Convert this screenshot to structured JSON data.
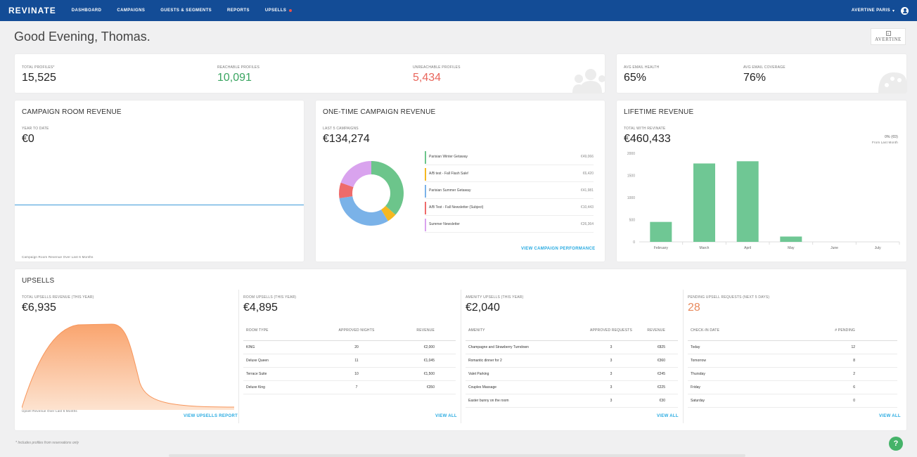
{
  "nav": {
    "logo": "REVINATE",
    "items": [
      "DASHBOARD",
      "CAMPAIGNS",
      "GUESTS & SEGMENTS",
      "REPORTS",
      "UPSELLS"
    ],
    "account": "AVERTINE PARIS",
    "accent": "#134c96"
  },
  "greeting": "Good Evening, Thomas.",
  "brand_logo": {
    "mark": "A",
    "name": "AVERTINE"
  },
  "profiles": {
    "total_label": "TOTAL PROFILES*",
    "total_value": "15,525",
    "reachable_label": "REACHABLE PROFILES",
    "reachable_value": "10,091",
    "unreachable_label": "UNREACHABLE PROFILES",
    "unreachable_value": "5,434"
  },
  "email": {
    "health_label": "AVG EMAIL HEALTH",
    "health_value": "65%",
    "coverage_label": "AVG EMAIL COVERAGE",
    "coverage_value": "76%"
  },
  "campaign_room": {
    "title": "CAMPAIGN ROOM REVENUE",
    "label": "YEAR TO DATE",
    "value": "€0",
    "caption": "Campaign Room Revenue Over Last 6 Months"
  },
  "one_time": {
    "title": "ONE-TIME CAMPAIGN REVENUE",
    "label": "LAST 5 CAMPAIGNS",
    "value": "€134,274",
    "link": "VIEW CAMPAIGN PERFORMANCE",
    "campaigns": [
      {
        "name": "Parisian Winter Getaway",
        "value": "€49,066",
        "color": "#6cc58b"
      },
      {
        "name": "A/B test - Fall Flash Sale!",
        "value": "€6,420",
        "color": "#f5b820"
      },
      {
        "name": "Parisian Summer Getaway",
        "value": "€41,981",
        "color": "#7ab2e8"
      },
      {
        "name": "A/B Test - Fall Newsletter (Subject)",
        "value": "€10,443",
        "color": "#ee6b6b"
      },
      {
        "name": "Summer Newsletter",
        "value": "€26,364",
        "color": "#d9a3ee"
      }
    ]
  },
  "lifetime": {
    "title": "LIFETIME REVENUE",
    "label": "TOTAL WITH REVINATE",
    "value": "€460,433",
    "change": "0% (€0)",
    "change_caption": "From Last Month"
  },
  "chart_data": {
    "type": "bar",
    "categories": [
      "February",
      "March",
      "April",
      "May",
      "June",
      "July"
    ],
    "values": [
      450,
      1770,
      1820,
      120,
      0,
      0
    ],
    "ylim": [
      0,
      2000
    ],
    "yticks": [
      "0",
      "500",
      "1000",
      "1500",
      "2000"
    ],
    "grid": false,
    "color": "#6fc794"
  },
  "upsells": {
    "title": "UPSELLS",
    "total_label": "TOTAL UPSELLS REVENUE (THIS YEAR)",
    "total_value": "€6,935",
    "chart_caption": "Upsell Revenue Over Last 6 Months",
    "report_link": "VIEW UPSELLS REPORT",
    "room": {
      "label": "ROOM UPSELLS (THIS YEAR)",
      "value": "€4,895",
      "headers": [
        "ROOM TYPE",
        "APPROVED NIGHTS",
        "REVENUE"
      ],
      "rows": [
        [
          "KING",
          "20",
          "€2,000"
        ],
        [
          "Deluxe Queen",
          "11",
          "€1,045"
        ],
        [
          "Terrace Suite",
          "10",
          "€1,500"
        ],
        [
          "Deluxe King",
          "7",
          "€350"
        ]
      ],
      "link": "VIEW ALL"
    },
    "amenity": {
      "label": "AMENITY UPSELLS (THIS YEAR)",
      "value": "€2,040",
      "headers": [
        "AMENITY",
        "APPROVED REQUESTS",
        "REVENUE"
      ],
      "rows": [
        [
          "Champagne and Strawberry Turndown",
          "3",
          "€825"
        ],
        [
          "Romantic dinner for 2",
          "3",
          "€360"
        ],
        [
          "Valet Parking",
          "3",
          "€245"
        ],
        [
          "Couples Massage",
          "3",
          "€225"
        ],
        [
          "Easter bunny on the room",
          "3",
          "€30"
        ]
      ],
      "link": "VIEW ALL"
    },
    "pending": {
      "label": "PENDING UPSELL REQUESTS (NEXT 5 DAYS)",
      "value": "28",
      "headers": [
        "CHECK-IN DATE",
        "# PENDING"
      ],
      "rows": [
        [
          "Today",
          "12"
        ],
        [
          "Tomorrow",
          "8"
        ],
        [
          "Thursday",
          "2"
        ],
        [
          "Friday",
          "6"
        ],
        [
          "Saturday",
          "0"
        ]
      ],
      "link": "VIEW ALL"
    }
  },
  "footnote": "* Includes profiles from reservations only",
  "help": "?"
}
